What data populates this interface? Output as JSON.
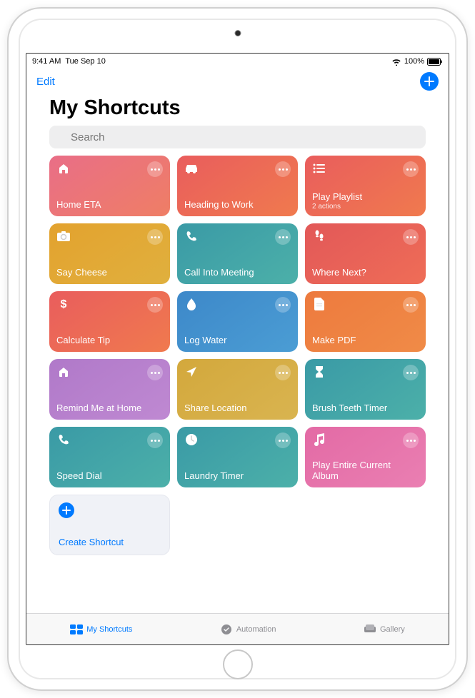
{
  "status": {
    "time": "9:41 AM",
    "date": "Tue Sep 10",
    "battery_pct": "100%"
  },
  "nav": {
    "edit_label": "Edit"
  },
  "page": {
    "title": "My Shortcuts"
  },
  "search": {
    "placeholder": "Search"
  },
  "shortcuts": [
    {
      "label": "Home ETA",
      "sublabel": "",
      "icon": "home",
      "color": "c-coral"
    },
    {
      "label": "Heading to Work",
      "sublabel": "",
      "icon": "car",
      "color": "c-red-orange"
    },
    {
      "label": "Play Playlist",
      "sublabel": "2 actions",
      "icon": "list",
      "color": "c-red-orange"
    },
    {
      "label": "Say Cheese",
      "sublabel": "",
      "icon": "camera",
      "color": "c-goldenrod"
    },
    {
      "label": "Call Into Meeting",
      "sublabel": "",
      "icon": "phone",
      "color": "c-teal"
    },
    {
      "label": "Where Next?",
      "sublabel": "",
      "icon": "footsteps",
      "color": "c-red"
    },
    {
      "label": "Calculate Tip",
      "sublabel": "",
      "icon": "dollar",
      "color": "c-red-orange"
    },
    {
      "label": "Log Water",
      "sublabel": "",
      "icon": "drop",
      "color": "c-blue"
    },
    {
      "label": "Make PDF",
      "sublabel": "",
      "icon": "doc",
      "color": "c-orange"
    },
    {
      "label": "Remind Me at Home",
      "sublabel": "",
      "icon": "home",
      "color": "c-purple"
    },
    {
      "label": "Share Location",
      "sublabel": "",
      "icon": "navigate",
      "color": "c-olive"
    },
    {
      "label": "Brush Teeth Timer",
      "sublabel": "",
      "icon": "hourglass",
      "color": "c-teal"
    },
    {
      "label": "Speed Dial",
      "sublabel": "",
      "icon": "phone",
      "color": "c-teal"
    },
    {
      "label": "Laundry Timer",
      "sublabel": "",
      "icon": "clock",
      "color": "c-teal"
    },
    {
      "label": "Play Entire Current Album",
      "sublabel": "",
      "icon": "music",
      "color": "c-pink"
    }
  ],
  "create": {
    "label": "Create Shortcut"
  },
  "tabs": {
    "shortcuts": "My Shortcuts",
    "automation": "Automation",
    "gallery": "Gallery"
  }
}
